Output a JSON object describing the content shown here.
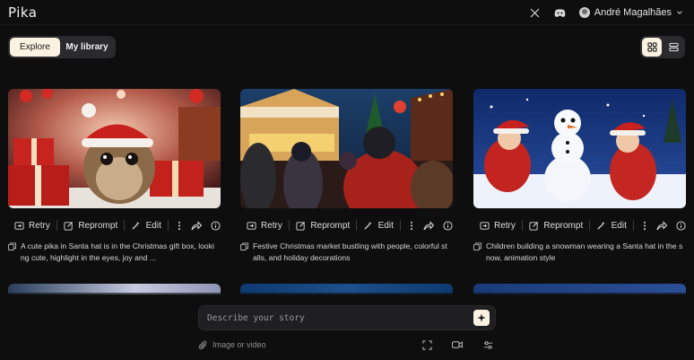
{
  "app": {
    "logo": "Pika"
  },
  "header": {
    "user_name": "André Magalhães"
  },
  "tabs": [
    {
      "label": "Explore",
      "active": true
    },
    {
      "label": "My library",
      "active": false
    }
  ],
  "view_toggle": {
    "active": "grid"
  },
  "actions": {
    "retry": "Retry",
    "reprompt": "Reprompt",
    "edit": "Edit"
  },
  "cards": [
    {
      "prompt_line1": "A cute pika in Santa hat is in the Christmas gift box, looki",
      "prompt_line2": "ng cute, highlight in the eyes, joy and ..."
    },
    {
      "prompt_line1": "Festive Christmas market bustling with people, colorful st",
      "prompt_line2": "alls, and holiday decorations"
    },
    {
      "prompt_line1": "Children building a snowman wearing a Santa hat in the s",
      "prompt_line2": "now, animation style"
    }
  ],
  "composer": {
    "placeholder": "Describe your story",
    "attach_label": "Image or video"
  },
  "colors": {
    "accent": "#fbf2e1",
    "background": "#0e0e0f",
    "panel": "#2a2a2c"
  }
}
